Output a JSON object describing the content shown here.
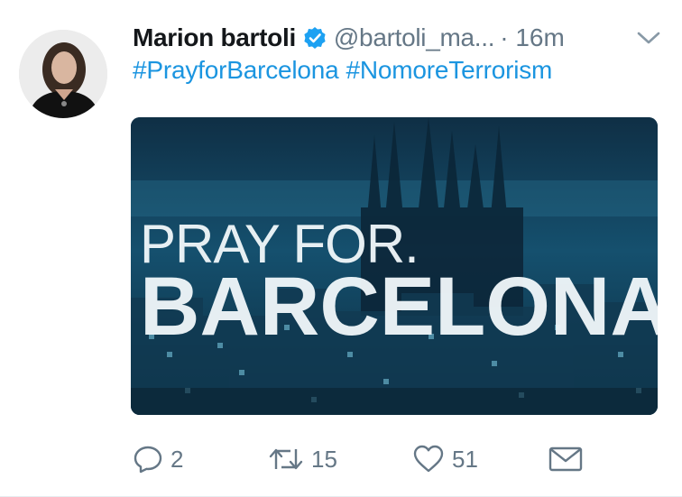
{
  "tweet": {
    "author": {
      "display_name": "Marion bartoli",
      "handle": "@bartoli_ma...",
      "verified": true
    },
    "timestamp": "· 16m",
    "hashtags": [
      "#PrayforBarcelona",
      "#NomoreTerrorism"
    ],
    "media": {
      "line1": "PRAY FOR.",
      "line2": "BARCELONA"
    },
    "actions": {
      "reply_count": "2",
      "retweet_count": "15",
      "like_count": "51"
    }
  },
  "icons": {
    "verified": "verified-badge-icon",
    "menu": "chevron-down-icon",
    "reply": "reply-icon",
    "retweet": "retweet-icon",
    "like": "heart-icon",
    "dm": "envelope-icon"
  },
  "colors": {
    "link": "#1b95e0",
    "verified": "#1da1f2",
    "muted": "#657786",
    "text": "#14171a"
  }
}
